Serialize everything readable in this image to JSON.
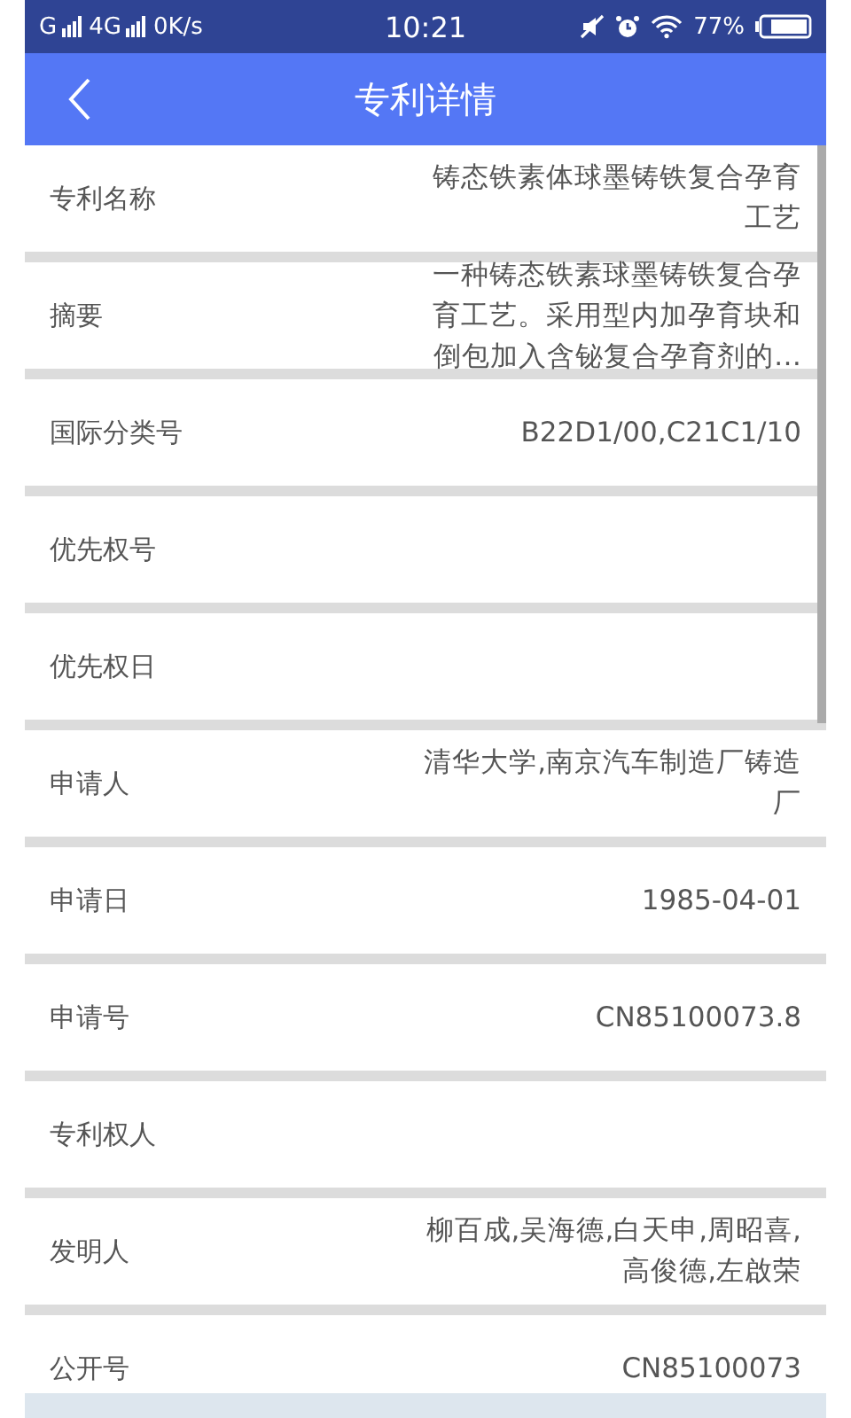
{
  "status_bar": {
    "network_1": "G",
    "network_2": "4G",
    "speed": "0K/s",
    "time": "10:21",
    "battery": "77%"
  },
  "header": {
    "title": "专利详情"
  },
  "fields": [
    {
      "label": "专利名称",
      "value": "铸态铁素体球墨铸铁复合孕育工艺"
    },
    {
      "label": "摘要",
      "value": "一种铸态铁素球墨铸铁复合孕育工艺。采用型内加孕育块和倒包加入含铋复合孕育剂的…"
    },
    {
      "label": "国际分类号",
      "value": "B22D1/00,C21C1/10"
    },
    {
      "label": "优先权号"
    },
    {
      "label": "优先权日"
    },
    {
      "label": "申请人",
      "value": "清华大学,南京汽车制造厂铸造厂"
    },
    {
      "label": "申请日",
      "value": "1985-04-01"
    },
    {
      "label": "申请号",
      "value": "CN85100073.8"
    },
    {
      "label": "专利权人"
    },
    {
      "label": "发明人",
      "value": "柳百成,吴海德,白天申,周昭喜,高俊德,左啟荣"
    },
    {
      "label": "公开号",
      "value": "CN85100073"
    }
  ]
}
